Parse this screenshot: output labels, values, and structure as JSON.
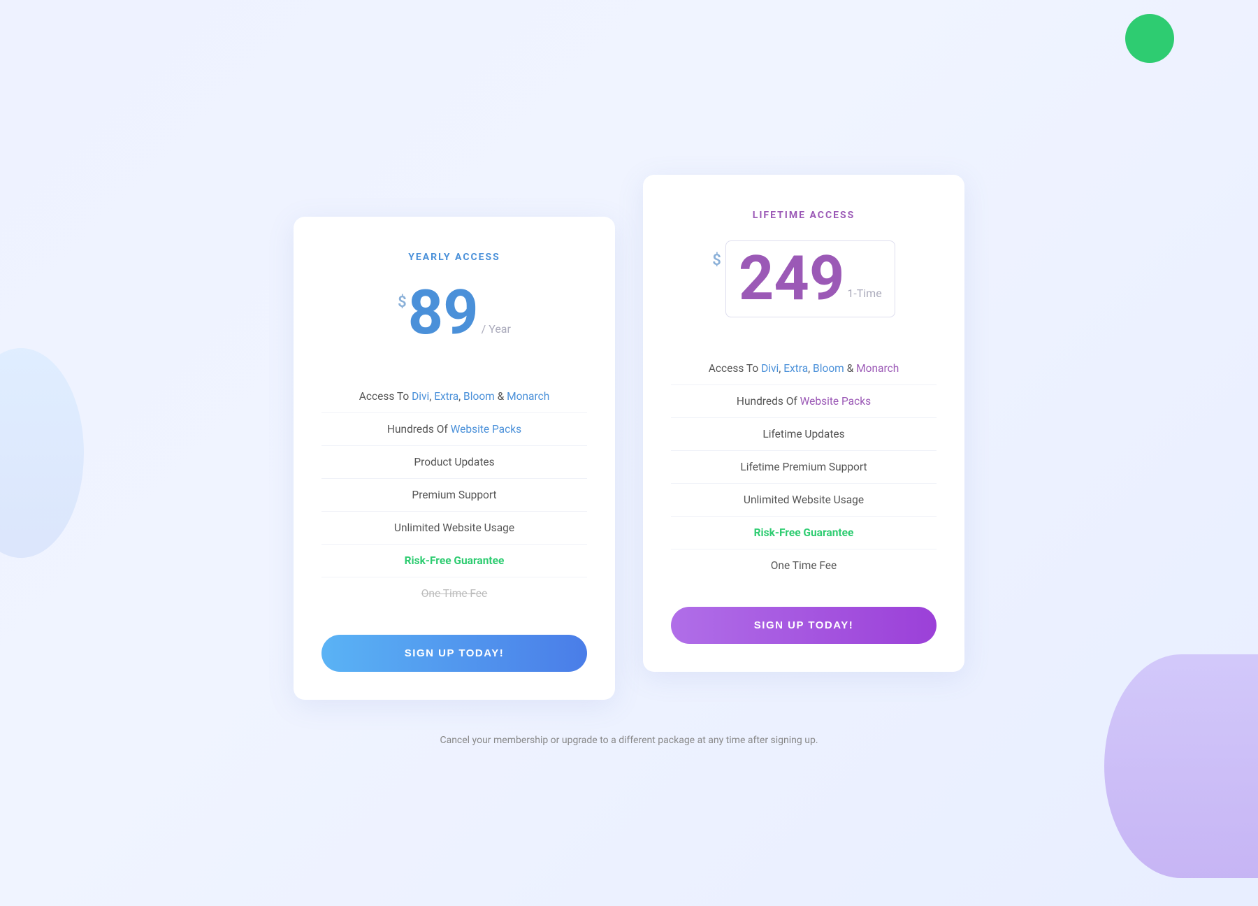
{
  "page": {
    "footer_note": "Cancel your membership or upgrade to a different package at any time after signing up."
  },
  "yearly_card": {
    "access_label": "YEARLY ACCESS",
    "price_dollar": "$",
    "price_amount": "89",
    "price_period": "/ Year",
    "features": [
      {
        "text_before": "Access To ",
        "links": [
          "Divi",
          "Extra",
          "Bloom"
        ],
        "ampersand": " & ",
        "last_link": "Monarch",
        "link_color": "blue",
        "last_color": "blue"
      },
      {
        "text_before": "Hundreds Of ",
        "link": "Website Packs",
        "link_color": "blue"
      },
      {
        "text": "Product Updates"
      },
      {
        "text": "Premium Support"
      },
      {
        "text": "Unlimited Website Usage"
      },
      {
        "text": "Risk-Free Guarantee",
        "color": "green"
      },
      {
        "text": "One Time Fee",
        "crossed": true
      }
    ],
    "button_label": "SIGN UP TODAY!"
  },
  "lifetime_card": {
    "access_label": "LIFETIME ACCESS",
    "price_dollar": "$",
    "price_amount": "249",
    "price_period": "1-Time",
    "features": [
      {
        "text_before": "Access To ",
        "links": [
          "Divi",
          "Extra",
          "Bloom"
        ],
        "ampersand": " & ",
        "last_link": "Monarch",
        "link_color": "blue",
        "last_color": "purple"
      },
      {
        "text_before": "Hundreds Of ",
        "link": "Website Packs",
        "link_color": "purple"
      },
      {
        "text": "Lifetime Updates"
      },
      {
        "text": "Lifetime Premium Support"
      },
      {
        "text": "Unlimited Website Usage"
      },
      {
        "text": "Risk-Free Guarantee",
        "color": "green"
      },
      {
        "text": "One Time Fee"
      }
    ],
    "button_label": "SIGN UP TODAY!"
  }
}
